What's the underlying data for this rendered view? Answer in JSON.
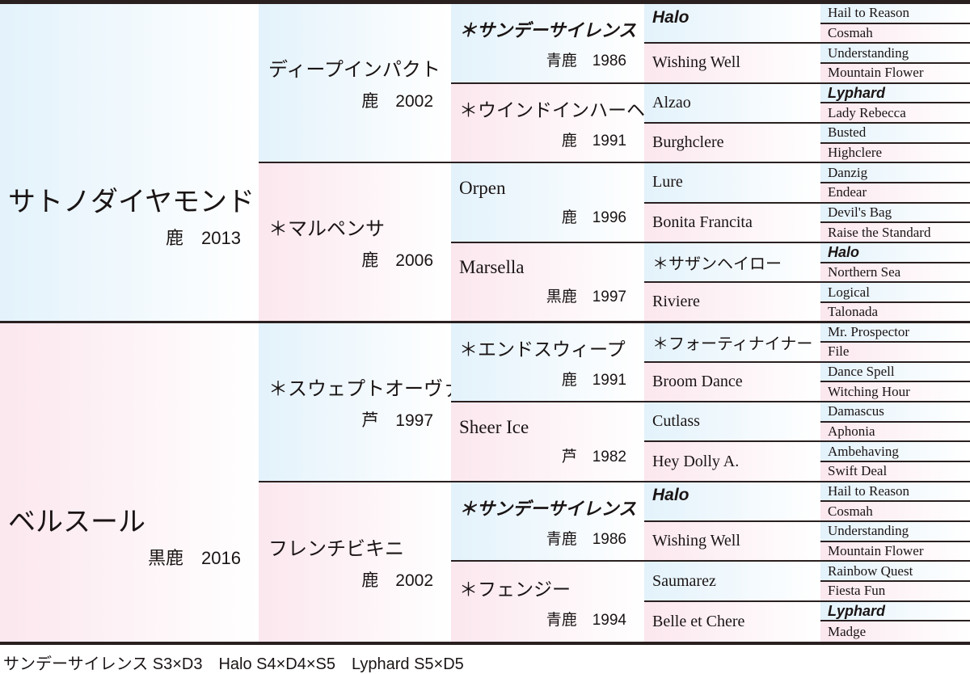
{
  "colors": {
    "sire_tint": "#e3f2fb",
    "dam_tint": "#fbe7ee",
    "rule": "#2a2020"
  },
  "pedigree": {
    "gen1": [
      {
        "name": "サトノダイヤモンド",
        "year": "鹿　2013"
      },
      {
        "name": "ベルスール",
        "year": "黒鹿　2016"
      }
    ],
    "gen2": [
      {
        "name": "ディープインパクト",
        "year": "鹿　2002"
      },
      {
        "name": "＊マルペンサ",
        "year": "鹿　2006"
      },
      {
        "name": "＊スウェプトオーヴァーボード",
        "year": "芦　1997"
      },
      {
        "name": "フレンチビキニ",
        "year": "鹿　2002"
      }
    ],
    "gen3": [
      {
        "name": "＊サンデーサイレンス",
        "year": "青鹿　1986",
        "highlight": true
      },
      {
        "name": "＊ウインドインハーヘア",
        "year": "鹿　1991"
      },
      {
        "name": "Orpen",
        "year": "鹿　1996"
      },
      {
        "name": "Marsella",
        "year": "黒鹿　1997"
      },
      {
        "name": "＊エンドスウィープ",
        "year": "鹿　1991"
      },
      {
        "name": "Sheer Ice",
        "year": "芦　1982"
      },
      {
        "name": "＊サンデーサイレンス",
        "year": "青鹿　1986",
        "highlight": true
      },
      {
        "name": "＊フェンジー",
        "year": "青鹿　1994"
      }
    ],
    "gen4": [
      {
        "name": "Halo",
        "highlight": true
      },
      {
        "name": "Wishing Well"
      },
      {
        "name": "Alzao"
      },
      {
        "name": "Burghclere"
      },
      {
        "name": "Lure"
      },
      {
        "name": "Bonita Francita"
      },
      {
        "name": "＊サザンヘイロー"
      },
      {
        "name": "Riviere"
      },
      {
        "name": "＊フォーティナイナー"
      },
      {
        "name": "Broom Dance"
      },
      {
        "name": "Cutlass"
      },
      {
        "name": "Hey Dolly A."
      },
      {
        "name": "Halo",
        "highlight": true
      },
      {
        "name": "Wishing Well"
      },
      {
        "name": "Saumarez"
      },
      {
        "name": "Belle et Chere"
      }
    ],
    "gen5": [
      {
        "name": "Hail to Reason"
      },
      {
        "name": "Cosmah"
      },
      {
        "name": "Understanding"
      },
      {
        "name": "Mountain Flower"
      },
      {
        "name": "Lyphard",
        "highlight": true
      },
      {
        "name": "Lady Rebecca"
      },
      {
        "name": "Busted"
      },
      {
        "name": "Highclere"
      },
      {
        "name": "Danzig"
      },
      {
        "name": "Endear"
      },
      {
        "name": "Devil's Bag"
      },
      {
        "name": "Raise the Standard"
      },
      {
        "name": "Halo",
        "highlight": true
      },
      {
        "name": "Northern Sea"
      },
      {
        "name": "Logical"
      },
      {
        "name": "Talonada"
      },
      {
        "name": "Mr. Prospector"
      },
      {
        "name": "File"
      },
      {
        "name": "Dance Spell"
      },
      {
        "name": "Witching Hour"
      },
      {
        "name": "Damascus"
      },
      {
        "name": "Aphonia"
      },
      {
        "name": "Ambehaving"
      },
      {
        "name": "Swift Deal"
      },
      {
        "name": "Hail to Reason"
      },
      {
        "name": "Cosmah"
      },
      {
        "name": "Understanding"
      },
      {
        "name": "Mountain Flower"
      },
      {
        "name": "Rainbow Quest"
      },
      {
        "name": "Fiesta Fun"
      },
      {
        "name": "Lyphard",
        "highlight": true
      },
      {
        "name": "Madge"
      }
    ]
  },
  "footer": {
    "inbreeding": "サンデーサイレンス S3×D3　Halo S4×D4×S5　Lyphard S5×D5"
  }
}
